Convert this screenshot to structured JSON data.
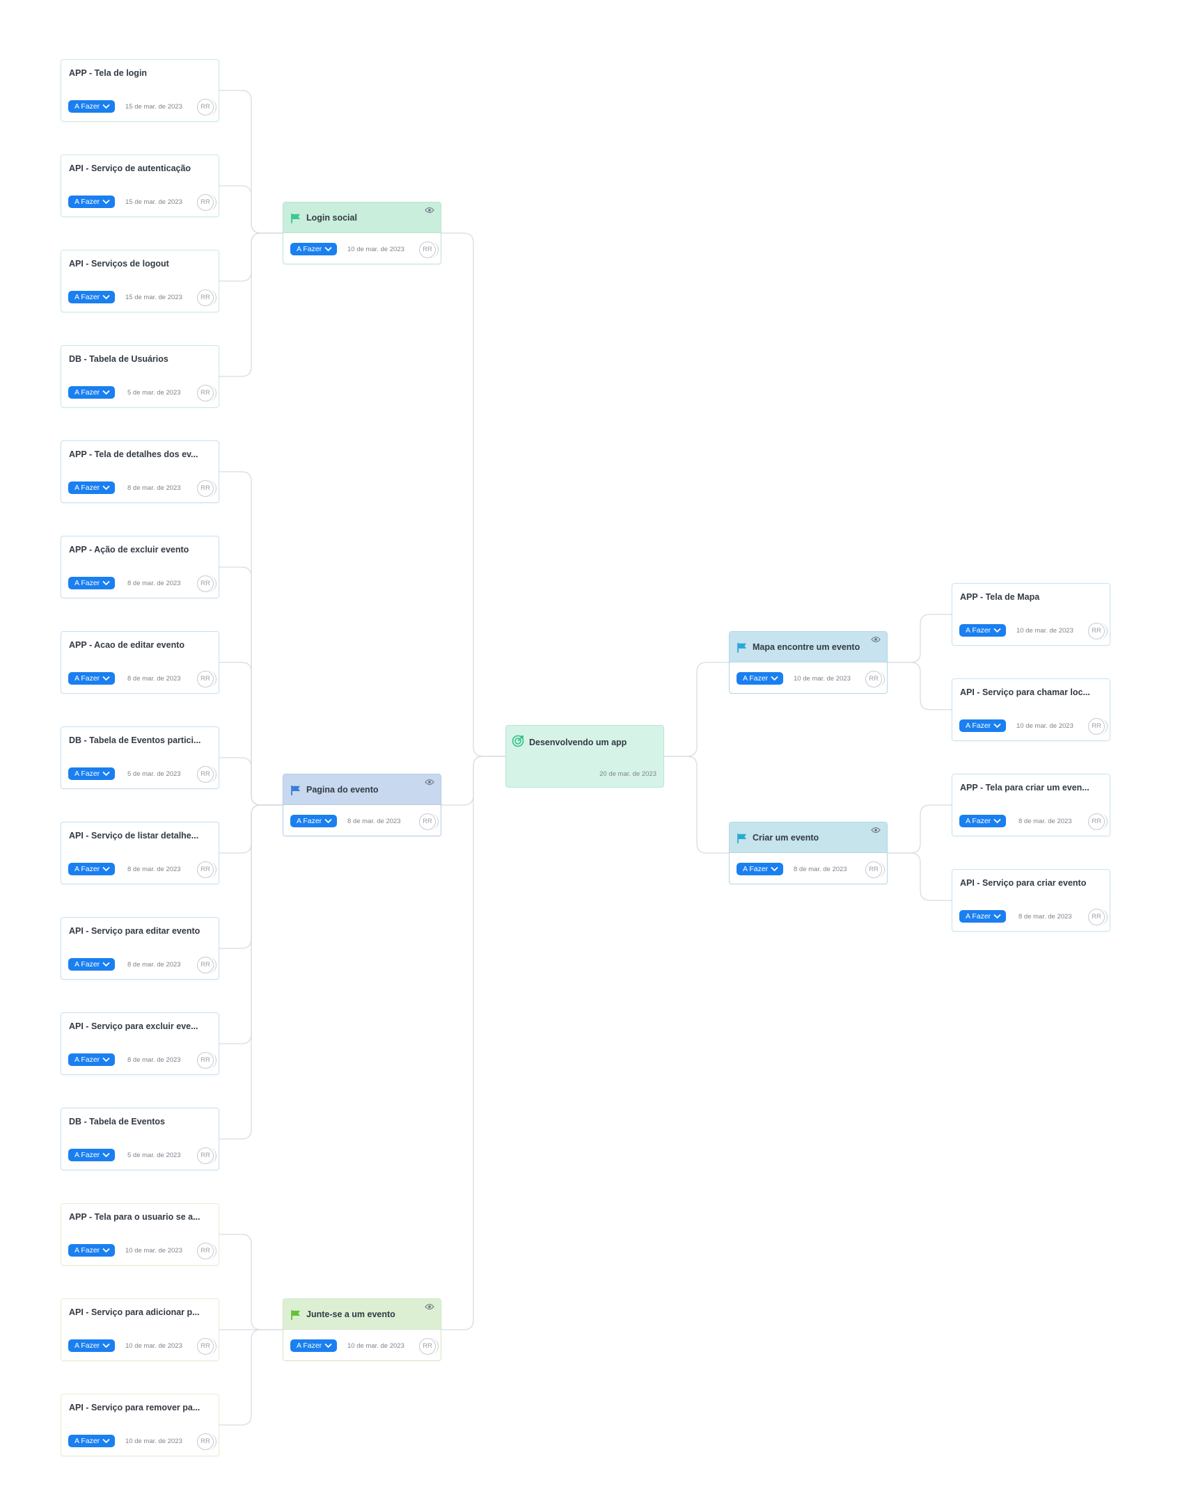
{
  "root": {
    "title": "Desenvolvendo um app",
    "date": "20 de mar. de 2023",
    "icon": "target-icon"
  },
  "avatar_initials": "RR",
  "status_label": "A Fazer",
  "groups": [
    {
      "title": "Login social",
      "date": "10 de mar. de 2023",
      "head_color": "#c9eedc",
      "border_color": "#b9e6cf",
      "flag_color": "#3bc98f",
      "children": [
        {
          "title": "APP - Tela de login",
          "date": "15 de mar. de 2023"
        },
        {
          "title": "API - Serviço de autenticação",
          "date": "15 de mar. de 2023"
        },
        {
          "title": "API - Serviços de logout",
          "date": "15 de mar. de 2023"
        },
        {
          "title": "DB - Tabela de Usuários",
          "date": "5 de mar. de 2023"
        }
      ]
    },
    {
      "title": "Pagina do evento",
      "date": "8 de mar. de 2023",
      "head_color": "#c7d8ef",
      "border_color": "#b5cbe8",
      "flag_color": "#3a7bd5",
      "children": [
        {
          "title": "APP - Tela de detalhes dos ev...",
          "date": "8 de mar. de 2023"
        },
        {
          "title": "APP - Ação de excluir evento",
          "date": "8 de mar. de 2023"
        },
        {
          "title": "APP - Acao de editar evento",
          "date": "8 de mar. de 2023"
        },
        {
          "title": "DB - Tabela de Eventos partici...",
          "date": "5 de mar. de 2023"
        },
        {
          "title": "API - Serviço de listar detalhe...",
          "date": "8 de mar. de 2023"
        },
        {
          "title": "API - Serviço para editar evento",
          "date": "8 de mar. de 2023"
        },
        {
          "title": "API - Serviço para excluir eve...",
          "date": "8 de mar. de 2023"
        },
        {
          "title": "DB - Tabela de Eventos",
          "date": "5 de mar. de 2023"
        }
      ]
    },
    {
      "title": "Junte-se a um evento",
      "date": "10 de mar. de 2023",
      "head_color": "#dcefd3",
      "border_color": "#d2e8c4",
      "flag_color": "#62c23a",
      "children": [
        {
          "title": "APP - Tela para o usuario se a...",
          "date": "10 de mar. de 2023"
        },
        {
          "title": "API - Serviço para adicionar p...",
          "date": "10 de mar. de 2023"
        },
        {
          "title": "API - Serviço para remover pa...",
          "date": "10 de mar. de 2023"
        }
      ]
    },
    {
      "title": "Mapa encontre um evento",
      "date": "10 de mar. de 2023",
      "head_color": "#c6e3ef",
      "border_color": "#b3d9ea",
      "flag_color": "#2aa7d9",
      "children": [
        {
          "title": "APP - Tela de Mapa",
          "date": "10 de mar. de 2023"
        },
        {
          "title": "API - Serviço para chamar loc...",
          "date": "10 de mar. de 2023"
        }
      ]
    },
    {
      "title": "Criar um evento",
      "date": "8 de mar. de 2023",
      "head_color": "#c6e4ec",
      "border_color": "#b3d9e4",
      "flag_color": "#29a9d2",
      "children": [
        {
          "title": "APP - Tela para criar um even...",
          "date": "8 de mar. de 2023"
        },
        {
          "title": "API - Serviço para criar evento",
          "date": "8 de mar. de 2023"
        }
      ]
    }
  ]
}
